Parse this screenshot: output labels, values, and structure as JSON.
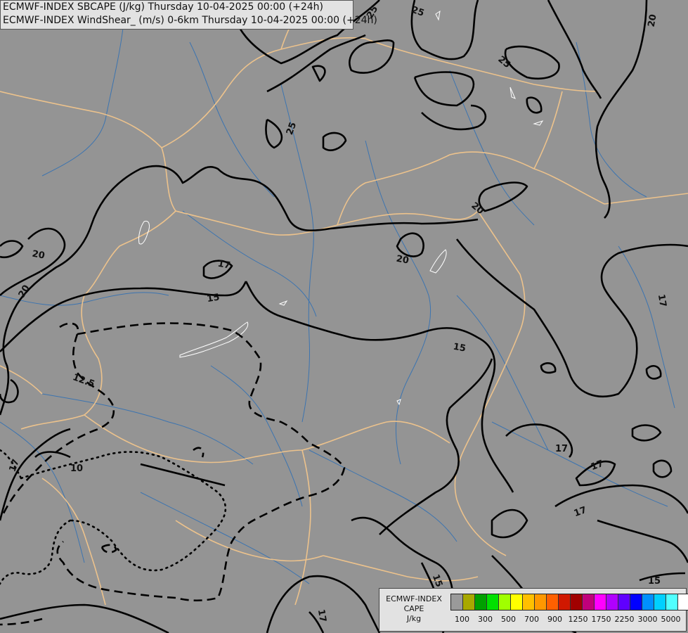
{
  "title_lines": [
    "ECMWF-INDEX SBCAPE (J/kg) Thursday 10-04-2025 00:00 (+24h)",
    "ECMWF-INDEX WindShear_ (m/s) 0-6km Thursday 10-04-2025 00:00 (+24h)"
  ],
  "legend": {
    "title_lines": [
      "ECMWF-INDEX",
      "CAPE",
      "J/kg"
    ],
    "colors": [
      "#9a9a9a",
      "#a8a800",
      "#00a000",
      "#00e000",
      "#a0ff00",
      "#ffff00",
      "#ffc000",
      "#ff9800",
      "#ff6000",
      "#d01800",
      "#a00000",
      "#c0007a",
      "#ff00ff",
      "#b000ff",
      "#6000ff",
      "#0000ff",
      "#0090ff",
      "#00d0ff",
      "#50ffff",
      "#ffffff"
    ],
    "tick_labels": [
      "100",
      "300",
      "500",
      "700",
      "900",
      "1250",
      "1750",
      "2250",
      "3000",
      "5000"
    ]
  },
  "contour_labels": [
    "25",
    "25",
    "25",
    "25",
    "20",
    "20",
    "20",
    "20",
    "20",
    "17",
    "17",
    "17",
    "17",
    "17",
    "17",
    "15",
    "15",
    "15",
    "15",
    "12.5",
    "10"
  ],
  "colors": {
    "background": "#949494",
    "borders": "#ecc28c",
    "rivers": "#3c74b0",
    "contours": "#000000",
    "lakes": "#ffffff"
  }
}
